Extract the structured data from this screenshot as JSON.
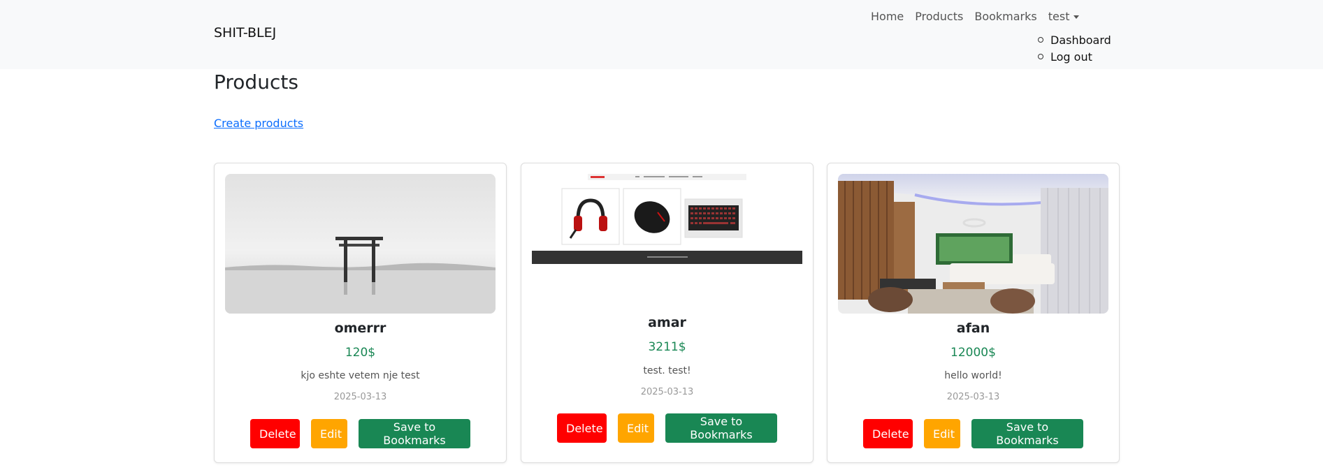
{
  "navbar": {
    "brand": "SHIT-BLEJ",
    "links": [
      "Home",
      "Products",
      "Bookmarks"
    ],
    "user": "test",
    "dropdown": [
      "Dashboard",
      "Log out"
    ]
  },
  "page": {
    "title": "Products",
    "create_link": "Create products"
  },
  "buttons": {
    "delete": "Delete",
    "edit": "Edit",
    "save": "Save to Bookmarks"
  },
  "products": [
    {
      "name": "omerrr",
      "price": "120$",
      "description": "kjo eshte vetem nje test",
      "date": "2025-03-13",
      "image": "torii-gate-photo"
    },
    {
      "name": "amar",
      "price": "3211$",
      "description": "test. test!",
      "date": "2025-03-13",
      "image": "store-screenshot"
    },
    {
      "name": "afan",
      "price": "12000$",
      "description": "hello world!",
      "date": "2025-03-13",
      "image": "living-room-photo"
    }
  ],
  "colors": {
    "delete": "#ff0000",
    "edit": "#ffa500",
    "save": "#198754",
    "price": "#198754",
    "link": "#0d6efd"
  }
}
